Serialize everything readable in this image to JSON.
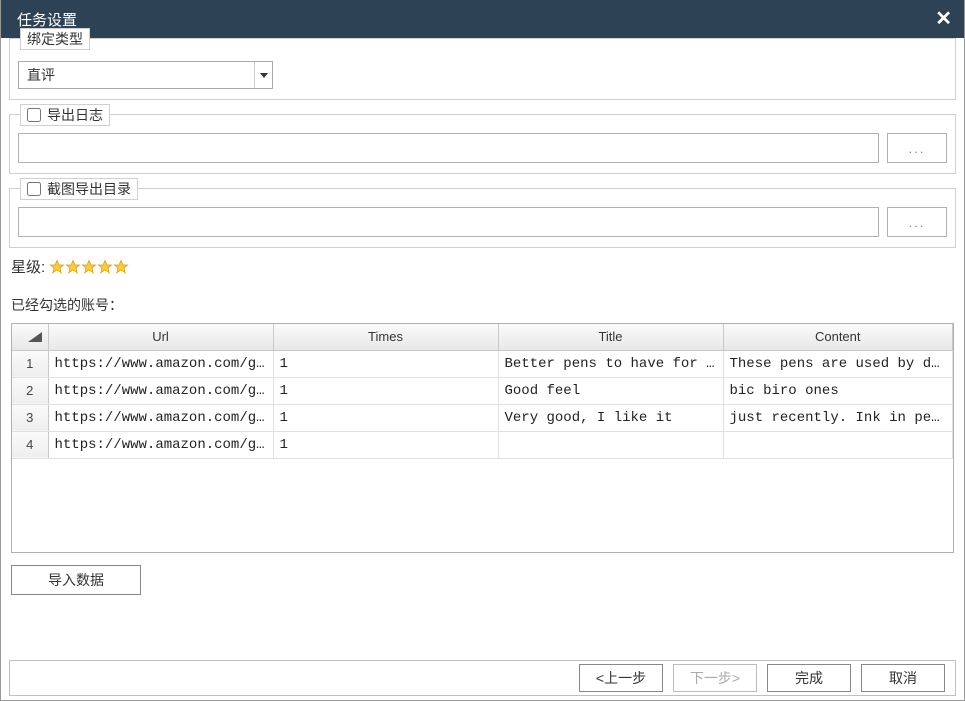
{
  "window": {
    "title": "任务设置"
  },
  "binding_type": {
    "legend": "绑定类型",
    "selected": "直评"
  },
  "export_log": {
    "legend": "导出日志",
    "checked": false,
    "browse": "..."
  },
  "screenshot_dir": {
    "legend": "截图导出目录",
    "checked": false,
    "browse": "..."
  },
  "stars": {
    "label": "星级:",
    "count": 5
  },
  "selected_accounts_label": "已经勾选的账号：",
  "table": {
    "headers": {
      "url": "Url",
      "times": "Times",
      "title": "Title",
      "content": "Content"
    },
    "rows": [
      {
        "n": "1",
        "url": "https://www.amazon.com/gp/...",
        "times": "1",
        "title": " Better pens to have for use",
        "content": "These pens are used by doc..."
      },
      {
        "n": "2",
        "url": "https://www.amazon.com/gp/...",
        "times": "1",
        "title": "Good feel",
        "content": "bic biro ones"
      },
      {
        "n": "3",
        "url": "https://www.amazon.com/gp/...",
        "times": "1",
        "title": "Very good, I like it",
        "content": "just recently. Ink in pens..."
      },
      {
        "n": "4",
        "url": "https://www.amazon.com/gp/...",
        "times": "1",
        "title": "",
        "content": ""
      }
    ]
  },
  "buttons": {
    "import": "导入数据",
    "prev": "<上一步",
    "next": "下一步>",
    "finish": "完成",
    "cancel": "取消"
  }
}
